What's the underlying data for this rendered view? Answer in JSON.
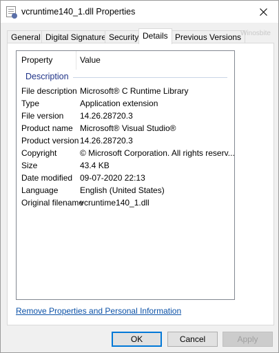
{
  "window": {
    "title": "vcruntime140_1.dll Properties",
    "icon": "dll-file-icon",
    "close_icon": "close-icon"
  },
  "tabs": [
    {
      "label": "General",
      "active": false
    },
    {
      "label": "Digital Signatures",
      "active": false
    },
    {
      "label": "Security",
      "active": false
    },
    {
      "label": "Details",
      "active": true
    },
    {
      "label": "Previous Versions",
      "active": false
    }
  ],
  "watermark": "Winosbite",
  "details": {
    "headers": {
      "property": "Property",
      "value": "Value"
    },
    "group": "Description",
    "rows": [
      {
        "property": "File description",
        "value": "Microsoft® C Runtime Library"
      },
      {
        "property": "Type",
        "value": "Application extension"
      },
      {
        "property": "File version",
        "value": "14.26.28720.3"
      },
      {
        "property": "Product name",
        "value": "Microsoft® Visual Studio®"
      },
      {
        "property": "Product version",
        "value": "14.26.28720.3"
      },
      {
        "property": "Copyright",
        "value": "© Microsoft Corporation. All rights reserv..."
      },
      {
        "property": "Size",
        "value": "43.4 KB"
      },
      {
        "property": "Date modified",
        "value": "09-07-2020 22:13"
      },
      {
        "property": "Language",
        "value": "English (United States)"
      },
      {
        "property": "Original filename",
        "value": "vcruntime140_1.dll"
      }
    ]
  },
  "link": "Remove Properties and Personal Information",
  "buttons": {
    "ok": "OK",
    "cancel": "Cancel",
    "apply": "Apply"
  },
  "colors": {
    "accent": "#0078d7",
    "link": "#0a50a6",
    "group": "#1e3287"
  }
}
